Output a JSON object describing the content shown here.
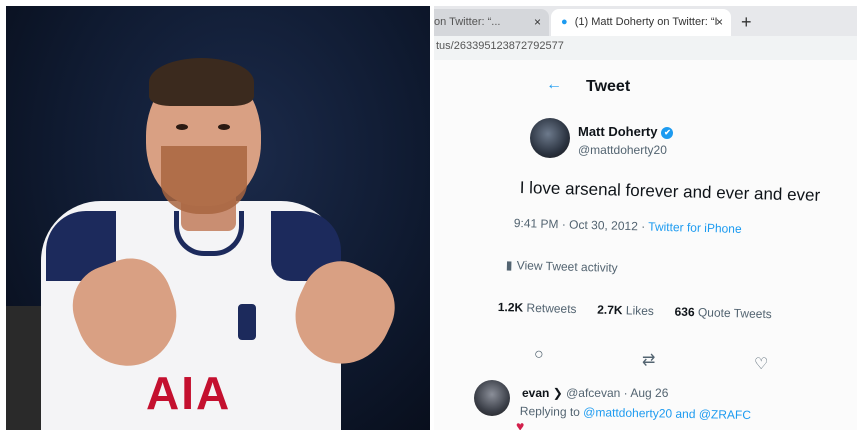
{
  "screen": {
    "tabs": [
      {
        "title": "on Twitter: “..."
      },
      {
        "title": "(1) Matt Doherty on Twitter: “I"
      }
    ],
    "tab_close_glyph": "×",
    "new_tab_glyph": "+",
    "url": "tus/263395123872792577",
    "header": {
      "back_icon": "arrow-left-icon",
      "title": "Tweet"
    },
    "tweet": {
      "display_name": "Matt Doherty",
      "verified_glyph": "✔",
      "handle": "@mattdoherty20",
      "text": "I love arsenal forever and ever and ever",
      "timestamp": "9:41 PM · Oct 30, 2012 · ",
      "source": "Twitter for iPhone",
      "activity": "View Tweet activity",
      "stats": {
        "retweets_count": "1.2K",
        "retweets_label": "Retweets",
        "likes_count": "2.7K",
        "likes_label": "Likes",
        "quote_count": "636",
        "quote_label": "Quote Tweets"
      }
    },
    "actions": {
      "reply_glyph": "○",
      "retweet_glyph": "⇄",
      "like_glyph": "♡"
    },
    "reply": {
      "name": "evan",
      "name_glyph": "❯",
      "handle": "@afcevan",
      "date": "· Aug 26",
      "replying_prefix": "Replying to ",
      "replying_to": "@mattdoherty20 and @ZRAFC",
      "heart_glyph": "♥"
    }
  },
  "photo": {
    "sponsor_text": "AIA"
  },
  "colors": {
    "twitter_blue": "#1d9bf0",
    "spurs_navy": "#1c2a5c",
    "sponsor_red": "#c4102f"
  }
}
